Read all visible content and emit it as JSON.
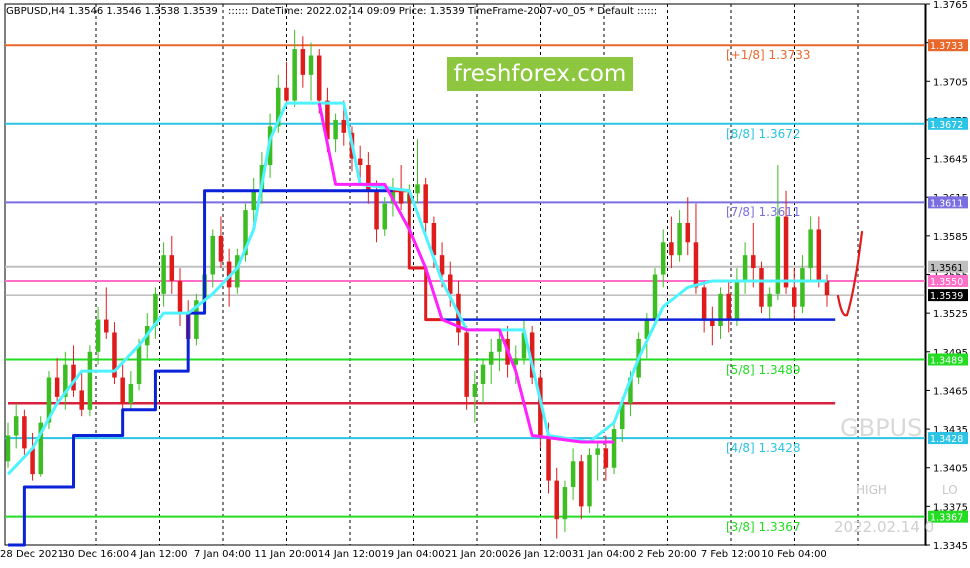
{
  "header": {
    "symbol": "GBPUSD,H4  1.3546 1.3546 1.3538 1.3539",
    "info": ":::::: DateTime: 2022.02.14 09:09    Price: 1.3539    TimeFrame-2007-v0_05    *  Default    ::::::"
  },
  "brand": "freshforex.com",
  "watermark": {
    "symbol": "GBPUS",
    "high": "HIGH",
    "low": "LO",
    "date": "2022.02.14 0"
  },
  "colors": {
    "bull": "#3cbd22",
    "bear": "#e01b1b",
    "cyan": "#4ff2ff",
    "magenta": "#ff22ff",
    "blue": "#0a22d8",
    "red": "#e01b1b",
    "orange": "#e8682c",
    "skyblue": "#2bc3e6",
    "purple": "#7a6ee0",
    "green": "#22dd22",
    "darkred": "#d8213d",
    "pink": "#ff6fc8"
  },
  "chart_data": {
    "type": "candlestick",
    "ylim": [
      1.3345,
      1.3765
    ],
    "y_ticks": [
      "1.3765",
      "1.3735",
      "1.3705",
      "1.3675",
      "1.3645",
      "1.3615",
      "1.3585",
      "1.3555",
      "1.3525",
      "1.3495",
      "1.3465",
      "1.3435",
      "1.3405",
      "1.3375",
      "1.3345"
    ],
    "x_ticks": [
      "28 Dec 2021",
      "30 Dec 16:00",
      "4 Jan 12:00",
      "7 Jan 04:00",
      "11 Jan 20:00",
      "14 Jan 12:00",
      "19 Jan 04:00",
      "21 Jan 20:00",
      "26 Jan 12:00",
      "31 Jan 04:00",
      "2 Feb 20:00",
      "7 Feb 12:00",
      "10 Feb 04:00"
    ],
    "current_price": "1.3539",
    "levels": [
      {
        "label": "[+1/8]",
        "value": "1.3733",
        "axis": "1.3733",
        "color": "orange",
        "show_label": true
      },
      {
        "label": "[8/8]",
        "value": "1.3672",
        "axis": "1.3672",
        "color": "skyblue",
        "show_label": true
      },
      {
        "label": "[7/8]",
        "value": "1.3611",
        "axis": "1.3611",
        "color": "purple",
        "show_label": true
      },
      {
        "label": "",
        "value": "",
        "axis": "1.3561",
        "color": "silver",
        "show_label": false
      },
      {
        "label": "",
        "value": "",
        "axis": "1.3550",
        "color": "pink",
        "show_label": false
      },
      {
        "label": "[5/8]",
        "value": "1.3489",
        "axis": "1.3489",
        "color": "green",
        "show_label": true
      },
      {
        "label": "[4/8]",
        "value": "1.3428",
        "axis": "1.3428",
        "color": "skyblue",
        "show_label": true
      },
      {
        "label": "[3/8]",
        "value": "1.3367",
        "axis": "1.3367",
        "color": "green",
        "show_label": true
      }
    ],
    "candles": [
      [
        1.341,
        1.344,
        1.3405,
        1.343
      ],
      [
        1.343,
        1.3455,
        1.342,
        1.3445
      ],
      [
        1.3445,
        1.345,
        1.3415,
        1.342
      ],
      [
        1.342,
        1.3432,
        1.3395,
        1.34
      ],
      [
        1.34,
        1.3445,
        1.3398,
        1.344
      ],
      [
        1.344,
        1.348,
        1.3435,
        1.3475
      ],
      [
        1.3475,
        1.349,
        1.3455,
        1.346
      ],
      [
        1.346,
        1.3495,
        1.345,
        1.3485
      ],
      [
        1.3485,
        1.35,
        1.346,
        1.3465
      ],
      [
        1.3465,
        1.348,
        1.3445,
        1.345
      ],
      [
        1.345,
        1.35,
        1.3445,
        1.3495
      ],
      [
        1.3495,
        1.353,
        1.3485,
        1.352
      ],
      [
        1.352,
        1.3545,
        1.3505,
        1.351
      ],
      [
        1.351,
        1.3518,
        1.347,
        1.3475
      ],
      [
        1.3475,
        1.3485,
        1.3445,
        1.3455
      ],
      [
        1.3455,
        1.348,
        1.345,
        1.347
      ],
      [
        1.347,
        1.3505,
        1.3465,
        1.35
      ],
      [
        1.35,
        1.3525,
        1.349,
        1.3515
      ],
      [
        1.3515,
        1.3545,
        1.3505,
        1.354
      ],
      [
        1.354,
        1.358,
        1.353,
        1.357
      ],
      [
        1.357,
        1.3585,
        1.354,
        1.355
      ],
      [
        1.355,
        1.356,
        1.3515,
        1.3525
      ],
      [
        1.3525,
        1.3535,
        1.349,
        1.3505
      ],
      [
        1.3505,
        1.354,
        1.35,
        1.3535
      ],
      [
        1.3535,
        1.356,
        1.3525,
        1.3555
      ],
      [
        1.3555,
        1.359,
        1.3545,
        1.3585
      ],
      [
        1.3585,
        1.36,
        1.356,
        1.3565
      ],
      [
        1.3565,
        1.3575,
        1.353,
        1.3545
      ],
      [
        1.3545,
        1.3575,
        1.354,
        1.357
      ],
      [
        1.357,
        1.361,
        1.3565,
        1.3605
      ],
      [
        1.3605,
        1.363,
        1.359,
        1.362
      ],
      [
        1.362,
        1.365,
        1.361,
        1.364
      ],
      [
        1.364,
        1.368,
        1.363,
        1.367
      ],
      [
        1.367,
        1.371,
        1.3665,
        1.37
      ],
      [
        1.37,
        1.372,
        1.3685,
        1.369
      ],
      [
        1.369,
        1.3745,
        1.3685,
        1.373
      ],
      [
        1.373,
        1.374,
        1.37,
        1.371
      ],
      [
        1.371,
        1.3735,
        1.369,
        1.3725
      ],
      [
        1.3725,
        1.373,
        1.368,
        1.369
      ],
      [
        1.369,
        1.37,
        1.365,
        1.366
      ],
      [
        1.366,
        1.368,
        1.365,
        1.3675
      ],
      [
        1.3675,
        1.369,
        1.3655,
        1.3665
      ],
      [
        1.3665,
        1.367,
        1.3635,
        1.3645
      ],
      [
        1.3645,
        1.3655,
        1.3625,
        1.364
      ],
      [
        1.364,
        1.365,
        1.361,
        1.362
      ],
      [
        1.362,
        1.3628,
        1.358,
        1.359
      ],
      [
        1.359,
        1.3615,
        1.3585,
        1.361
      ],
      [
        1.361,
        1.363,
        1.36,
        1.362
      ],
      [
        1.362,
        1.364,
        1.3605,
        1.361
      ],
      [
        1.361,
        1.3625,
        1.3595,
        1.3618
      ],
      [
        1.3618,
        1.366,
        1.361,
        1.3625
      ],
      [
        1.3625,
        1.363,
        1.3585,
        1.3595
      ],
      [
        1.3595,
        1.36,
        1.356,
        1.357
      ],
      [
        1.357,
        1.358,
        1.3545,
        1.3555
      ],
      [
        1.3555,
        1.3565,
        1.353,
        1.354
      ],
      [
        1.354,
        1.355,
        1.35,
        1.351
      ],
      [
        1.351,
        1.3515,
        1.345,
        1.346
      ],
      [
        1.346,
        1.348,
        1.344,
        1.347
      ],
      [
        1.347,
        1.349,
        1.3455,
        1.3485
      ],
      [
        1.3485,
        1.3505,
        1.347,
        1.3495
      ],
      [
        1.3495,
        1.351,
        1.348,
        1.3505
      ],
      [
        1.3505,
        1.3515,
        1.3475,
        1.3485
      ],
      [
        1.3485,
        1.35,
        1.347,
        1.349
      ],
      [
        1.349,
        1.352,
        1.3485,
        1.351
      ],
      [
        1.351,
        1.3515,
        1.347,
        1.3475
      ],
      [
        1.3475,
        1.348,
        1.342,
        1.343
      ],
      [
        1.343,
        1.344,
        1.3385,
        1.3395
      ],
      [
        1.3395,
        1.3405,
        1.335,
        1.3365
      ],
      [
        1.3365,
        1.3395,
        1.3355,
        1.339
      ],
      [
        1.339,
        1.342,
        1.338,
        1.341
      ],
      [
        1.341,
        1.3415,
        1.3365,
        1.3375
      ],
      [
        1.3375,
        1.342,
        1.337,
        1.3415
      ],
      [
        1.3415,
        1.3425,
        1.3395,
        1.342
      ],
      [
        1.342,
        1.343,
        1.3395,
        1.3405
      ],
      [
        1.3405,
        1.344,
        1.34,
        1.3435
      ],
      [
        1.3435,
        1.346,
        1.3425,
        1.3455
      ],
      [
        1.3455,
        1.348,
        1.3445,
        1.3475
      ],
      [
        1.3475,
        1.351,
        1.347,
        1.3505
      ],
      [
        1.3505,
        1.3525,
        1.349,
        1.352
      ],
      [
        1.352,
        1.356,
        1.3515,
        1.3555
      ],
      [
        1.3555,
        1.359,
        1.3545,
        1.358
      ],
      [
        1.358,
        1.36,
        1.356,
        1.357
      ],
      [
        1.357,
        1.3605,
        1.3565,
        1.3595
      ],
      [
        1.3595,
        1.3615,
        1.357,
        1.358
      ],
      [
        1.358,
        1.361,
        1.354,
        1.3545
      ],
      [
        1.3545,
        1.355,
        1.351,
        1.352
      ],
      [
        1.352,
        1.353,
        1.35,
        1.3515
      ],
      [
        1.3515,
        1.3545,
        1.3505,
        1.354
      ],
      [
        1.354,
        1.355,
        1.351,
        1.352
      ],
      [
        1.352,
        1.356,
        1.3515,
        1.355
      ],
      [
        1.355,
        1.358,
        1.354,
        1.357
      ],
      [
        1.357,
        1.3595,
        1.3545,
        1.356
      ],
      [
        1.356,
        1.3565,
        1.3525,
        1.353
      ],
      [
        1.353,
        1.3545,
        1.352,
        1.354
      ],
      [
        1.354,
        1.364,
        1.3535,
        1.36
      ],
      [
        1.36,
        1.362,
        1.354,
        1.3545
      ],
      [
        1.3545,
        1.356,
        1.352,
        1.353
      ],
      [
        1.353,
        1.357,
        1.3525,
        1.356
      ],
      [
        1.356,
        1.36,
        1.355,
        1.359
      ],
      [
        1.359,
        1.36,
        1.3545,
        1.355
      ],
      [
        1.355,
        1.3555,
        1.353,
        1.3539
      ]
    ],
    "indicators": {
      "cyan_line": [
        [
          0,
          1.34
        ],
        [
          3,
          1.342
        ],
        [
          6,
          1.3455
        ],
        [
          9,
          1.348
        ],
        [
          13,
          1.348
        ],
        [
          16,
          1.35
        ],
        [
          19,
          1.3525
        ],
        [
          22,
          1.3525
        ],
        [
          25,
          1.354
        ],
        [
          28,
          1.356
        ],
        [
          30,
          1.359
        ],
        [
          32,
          1.366
        ],
        [
          34,
          1.3688
        ],
        [
          41,
          1.3688
        ],
        [
          43,
          1.3625
        ],
        [
          49,
          1.362
        ],
        [
          53,
          1.355
        ],
        [
          56,
          1.3512
        ],
        [
          63,
          1.3512
        ],
        [
          66,
          1.343
        ],
        [
          71,
          1.3425
        ],
        [
          74,
          1.344
        ],
        [
          77,
          1.349
        ],
        [
          80,
          1.353
        ],
        [
          83,
          1.3545
        ],
        [
          86,
          1.355
        ],
        [
          100,
          1.355
        ]
      ],
      "magenta_line": [
        [
          38,
          1.3688
        ],
        [
          40,
          1.3625
        ],
        [
          46,
          1.3625
        ],
        [
          49,
          1.359
        ],
        [
          51,
          1.356
        ],
        [
          53,
          1.352
        ],
        [
          56,
          1.3512
        ],
        [
          60,
          1.3512
        ],
        [
          62,
          1.348
        ],
        [
          64,
          1.343
        ],
        [
          70,
          1.3425
        ],
        [
          74,
          1.3425
        ]
      ],
      "blue_line": [
        [
          0,
          1.3345
        ],
        [
          2,
          1.3345
        ],
        [
          2,
          1.339
        ],
        [
          8,
          1.339
        ],
        [
          8,
          1.343
        ],
        [
          14,
          1.343
        ],
        [
          14,
          1.345
        ],
        [
          18,
          1.345
        ],
        [
          18,
          1.348
        ],
        [
          22,
          1.348
        ],
        [
          22,
          1.3525
        ],
        [
          24,
          1.3525
        ],
        [
          24,
          1.362
        ],
        [
          47,
          1.362
        ]
      ],
      "red_line": [
        [
          47,
          1.362
        ],
        [
          49,
          1.362
        ],
        [
          49,
          1.356
        ],
        [
          51,
          1.356
        ],
        [
          51,
          1.352
        ],
        [
          53,
          1.352
        ]
      ],
      "blue_line_2": [
        [
          53,
          1.352
        ],
        [
          101,
          1.352
        ]
      ],
      "darkred_level": [
        [
          0,
          1.3455
        ],
        [
          101,
          1.3455
        ]
      ]
    },
    "annotations": {
      "arrow_type": "hand-drawn-v"
    }
  }
}
